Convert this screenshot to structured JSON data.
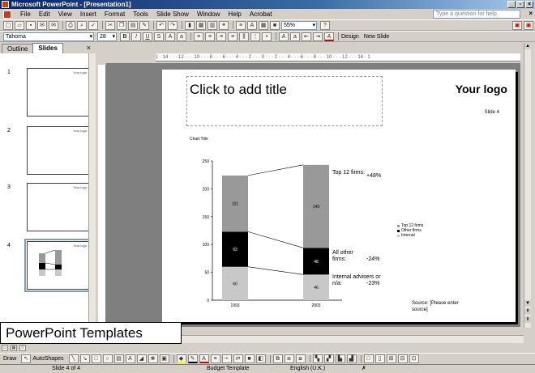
{
  "window": {
    "title": "Microsoft PowerPoint - [Presentation1]"
  },
  "menu": {
    "items": [
      "File",
      "Edit",
      "View",
      "Insert",
      "Format",
      "Tools",
      "Slide Show",
      "Window",
      "Help",
      "Acrobat"
    ],
    "help_box_placeholder": "Type a question for help"
  },
  "toolbar": {
    "zoom": "55%",
    "font_name": "Tahoma",
    "font_size": "28",
    "design_label": "Design",
    "new_slide_label": "New Slide"
  },
  "panes": {
    "tabs": [
      "Outline",
      "Slides"
    ],
    "active_tab": "Slides",
    "thumbnails": [
      {
        "number": "1",
        "logo": "Your logo"
      },
      {
        "number": "2",
        "logo": "Your logo"
      },
      {
        "number": "3",
        "logo": "Your logo"
      },
      {
        "number": "4",
        "logo": "Your logo"
      }
    ]
  },
  "rulers": {
    "horizontal": "1 · 14 · · · 12 · · · 10 · · · 8 · · · 6 · · · 4 · · · 2 · · · 0 · · · 2 · · · 4 · · · 6 · · · 8 · · · 10 · · · 12 · · · 14 · 1"
  },
  "slide": {
    "title_placeholder": "Click to add title",
    "logo": "Your logo",
    "slide_number": "Slide 4",
    "source_note": "Source: [Please enter source]"
  },
  "chart_data": {
    "type": "bar",
    "stacked": true,
    "title": "Chart Title",
    "categories": [
      "1993",
      "2003"
    ],
    "ylim": [
      0,
      250
    ],
    "yticks": [
      0,
      50,
      100,
      150,
      200,
      250
    ],
    "series": [
      {
        "name": "Internal",
        "values": [
          60,
          46
        ],
        "color": "#c8c8c8"
      },
      {
        "name": "Other firms",
        "values": [
          63,
          48
        ],
        "color": "#000000"
      },
      {
        "name": "Top 12 firms",
        "values": [
          101,
          149
        ],
        "color": "#999999"
      }
    ],
    "annotations": [
      {
        "label": "Top 12 firms:",
        "change": "+48%"
      },
      {
        "label": "All other firms:",
        "change": "-24%"
      },
      {
        "label": "Internal advisers or n/a:",
        "change": "-23%"
      }
    ],
    "legend_position": "right"
  },
  "banner": {
    "text": "PowerPoint Templates"
  },
  "drawbar": {
    "draw_label": "Draw",
    "autoshapes_label": "AutoShapes"
  },
  "status": {
    "slide_pos": "Slide 4 of 4",
    "template": "Budget Template",
    "language": "English (U.K.)"
  }
}
